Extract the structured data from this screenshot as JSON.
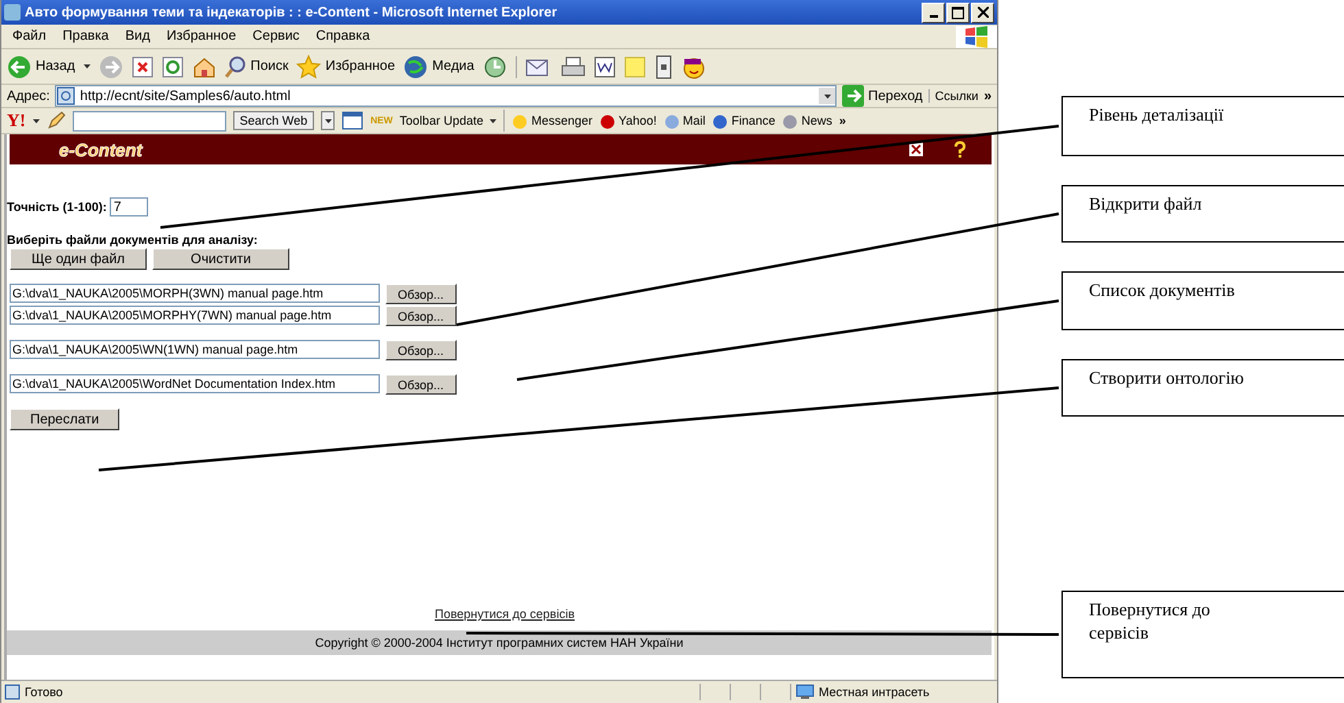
{
  "window": {
    "title": "Авто формування теми та індекаторів : : e-Content - Microsoft Internet Explorer"
  },
  "menu": [
    "Файл",
    "Правка",
    "Вид",
    "Избранное",
    "Сервис",
    "Справка"
  ],
  "toolbar": {
    "back": "Назад",
    "search": "Поиск",
    "favorites": "Избранное",
    "media": "Медиа"
  },
  "address_bar": {
    "label": "Адрес:",
    "url": "http://ecnt/site/Samples6/auto.html",
    "go": "Переход",
    "links": "Ссылки",
    "more": "»"
  },
  "yahoo_bar": {
    "logo": "Y!",
    "search_button": "Search Web",
    "new_badge": "NEW",
    "update": "Toolbar Update",
    "items": [
      "Messenger",
      "Yahoo!",
      "Mail",
      "Finance",
      "News"
    ],
    "more": "»"
  },
  "page": {
    "logo": "e-Content",
    "precision": {
      "label": "Точність (1-100):",
      "value": "7"
    },
    "files_label": "Виберіть файли документів для аналізу:",
    "buttons": [
      "Ще один файл",
      "Очистити"
    ],
    "file_groups": [
      [
        {
          "path": "G:\\dva\\1_NAUKA\\2005\\MORPH(3WN) manual page.htm",
          "browse": "Обзор..."
        },
        {
          "path": "G:\\dva\\1_NAUKA\\2005\\MORPHY(7WN) manual page.htm",
          "browse": "Обзор..."
        }
      ],
      [
        {
          "path": "G:\\dva\\1_NAUKA\\2005\\WN(1WN) manual page.htm",
          "browse": "Обзор..."
        }
      ],
      [
        {
          "path": "G:\\dva\\1_NAUKA\\2005\\WordNet Documentation Index.htm",
          "browse": "Обзор..."
        }
      ]
    ],
    "submit": "Переслати",
    "back_link": "Повернутися до сервісів",
    "footer": "Copyright © 2000-2004 Інститут програмних систем НАН України"
  },
  "status_bar": {
    "status": "Готово",
    "zone": "Местная интрасеть"
  },
  "callouts": [
    "Рівень деталізації",
    "Відкрити файл",
    "Список документів",
    "Створити онтологію",
    "Повернутися до сервісів"
  ]
}
